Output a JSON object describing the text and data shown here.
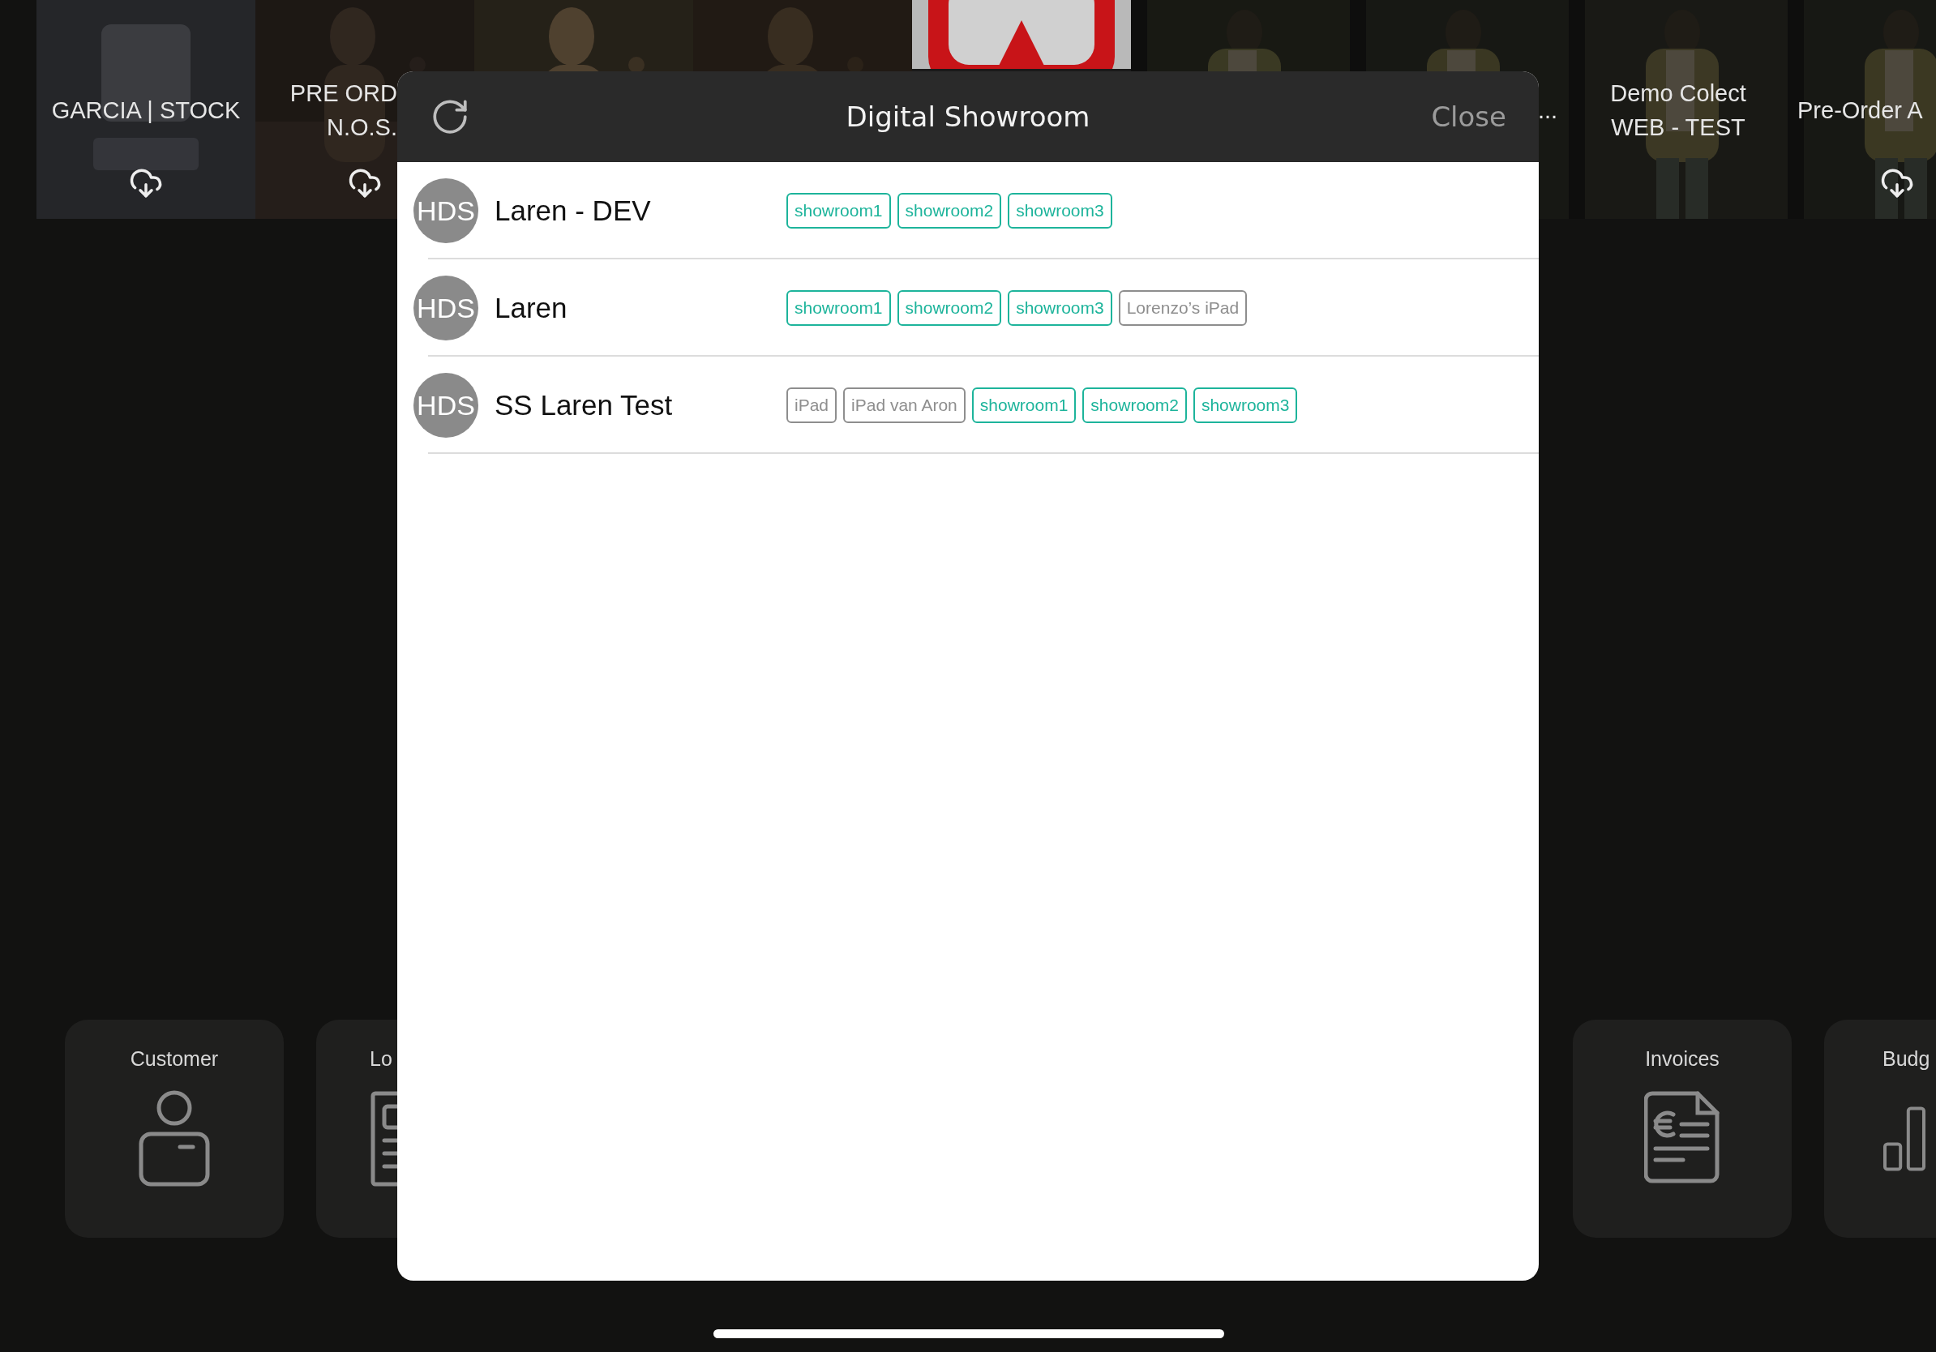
{
  "collections": [
    {
      "title_lines": [
        "GARCIA | STOCK"
      ],
      "download": true
    },
    {
      "title_lines": [
        "PRE ORD",
        "N.O.S."
      ],
      "download": true
    },
    {
      "download": false
    },
    {
      "download": false
    },
    {
      "download": false
    },
    {
      "download": false
    },
    {
      "title_lines": [
        "..."
      ],
      "download": false
    },
    {
      "title_lines": [
        "Demo Colect",
        "WEB - TEST"
      ],
      "download": false
    },
    {
      "title_lines": [
        "Pre-Order A"
      ],
      "download": true
    }
  ],
  "modules": [
    {
      "label": "Customer",
      "kind": "person"
    },
    {
      "label": "Lo",
      "kind": "document"
    },
    {
      "label": "Invoices",
      "kind": "invoice"
    },
    {
      "label": "Budg",
      "kind": "chart"
    }
  ],
  "dialog": {
    "title": "Digital Showroom",
    "close": "Close",
    "rows": [
      {
        "avatar": "HDS",
        "name": "Laren - DEV",
        "tags": [
          {
            "text": "showroom1",
            "color": "#1db49b"
          },
          {
            "text": "showroom2",
            "color": "#1db49b"
          },
          {
            "text": "showroom3",
            "color": "#1db49b"
          }
        ]
      },
      {
        "avatar": "HDS",
        "name": "Laren",
        "tags": [
          {
            "text": "showroom1",
            "color": "#1db49b"
          },
          {
            "text": "showroom2",
            "color": "#1db49b"
          },
          {
            "text": "showroom3",
            "color": "#1db49b"
          },
          {
            "text": "Lorenzo’s iPad",
            "color": "#8e8e8e"
          }
        ]
      },
      {
        "avatar": "HDS",
        "name": "SS Laren Test",
        "tags": [
          {
            "text": "iPad",
            "color": "#8e8e8e"
          },
          {
            "text": "iPad van Aron",
            "color": "#8e8e8e"
          },
          {
            "text": "showroom1",
            "color": "#1db49b"
          },
          {
            "text": "showroom2",
            "color": "#1db49b"
          },
          {
            "text": "showroom3",
            "color": "#1db49b"
          }
        ]
      }
    ]
  }
}
